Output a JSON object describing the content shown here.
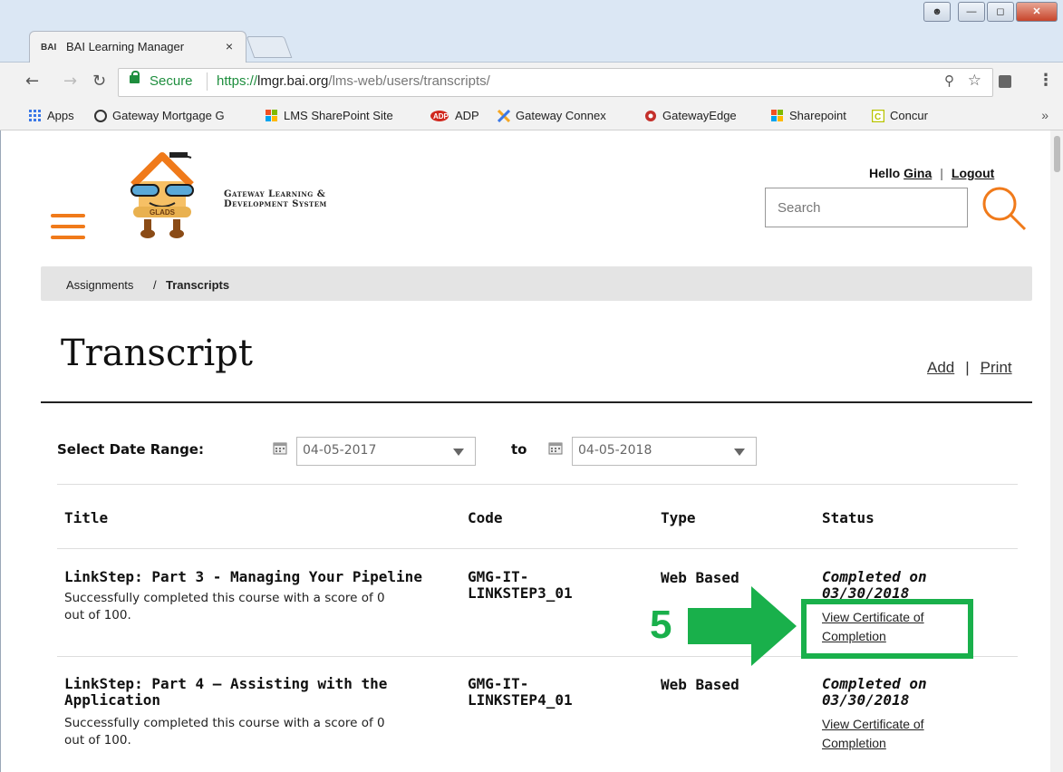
{
  "browser": {
    "tab_title": "BAI Learning Manager",
    "tab_favicon": "BAI",
    "tab_close": "×",
    "address": {
      "secure_label": "Secure",
      "scheme": "https://",
      "host": "lmgr.bai.org",
      "path": "/lms-web/users/transcripts/"
    },
    "bookmarks": [
      {
        "label": "Apps",
        "icon": "apps-grid-icon",
        "color": "#3b78e7"
      },
      {
        "label": "Gateway Mortgage G",
        "icon": "gateway-icon",
        "color": "#333333"
      },
      {
        "label": "LMS SharePoint Site",
        "icon": "windows-icon",
        "color": "#f25022"
      },
      {
        "label": "ADP",
        "icon": "adp-icon",
        "color": "#d0271d"
      },
      {
        "label": "Gateway Connex",
        "icon": "x-logo-icon",
        "color": "#f5a623"
      },
      {
        "label": "GatewayEdge",
        "icon": "edge-icon",
        "color": "#c4302b"
      },
      {
        "label": "Sharepoint",
        "icon": "windows-icon",
        "color": "#f25022"
      },
      {
        "label": "Concur",
        "icon": "concur-icon",
        "color": "#b8c400"
      }
    ],
    "bookmarks_overflow": "»"
  },
  "header": {
    "logo_line1": "Gateway Learning &",
    "logo_line2": "Development System",
    "logo_badge": "GLADS",
    "hello_prefix": "Hello",
    "user_name": "Gina",
    "logout": "Logout",
    "search_placeholder": "Search"
  },
  "breadcrumb": {
    "parent": "Assignments",
    "separator": "/",
    "current": "Transcripts"
  },
  "page": {
    "title": "Transcript",
    "add": "Add",
    "print": "Print"
  },
  "filters": {
    "label": "Select Date Range:",
    "from": "04-05-2017",
    "to_label": "to",
    "to": "04-05-2018"
  },
  "table": {
    "headers": {
      "title": "Title",
      "code": "Code",
      "type": "Type",
      "status": "Status"
    },
    "rows": [
      {
        "title": "LinkStep: Part 3 - Managing Your Pipeline",
        "desc_line1": "Successfully completed this course with a score of 0",
        "desc_line2": "out of 100.",
        "code_line1": "GMG-IT-",
        "code_line2": "LINKSTEP3_01",
        "type": "Web Based",
        "status_line1": "Completed on",
        "status_line2": "03/30/2018",
        "cert_line1": "View Certificate of",
        "cert_line2": "Completion"
      },
      {
        "title_line1": "LinkStep: Part 4 – Assisting with the",
        "title_line2": "Application",
        "desc_line1": "Successfully completed this course with a score of 0",
        "desc_line2": "out of 100.",
        "code_line1": "GMG-IT-",
        "code_line2": "LINKSTEP4_01",
        "type": "Web Based",
        "status_line1": "Completed on",
        "status_line2": "03/30/2018",
        "cert_line1": "View Certificate of",
        "cert_line2": "Completion"
      }
    ]
  },
  "annotation": {
    "step": "5",
    "color": "#19b04b"
  },
  "colors": {
    "accent": "#f07a1a",
    "secure_green": "#1e8e3e"
  }
}
